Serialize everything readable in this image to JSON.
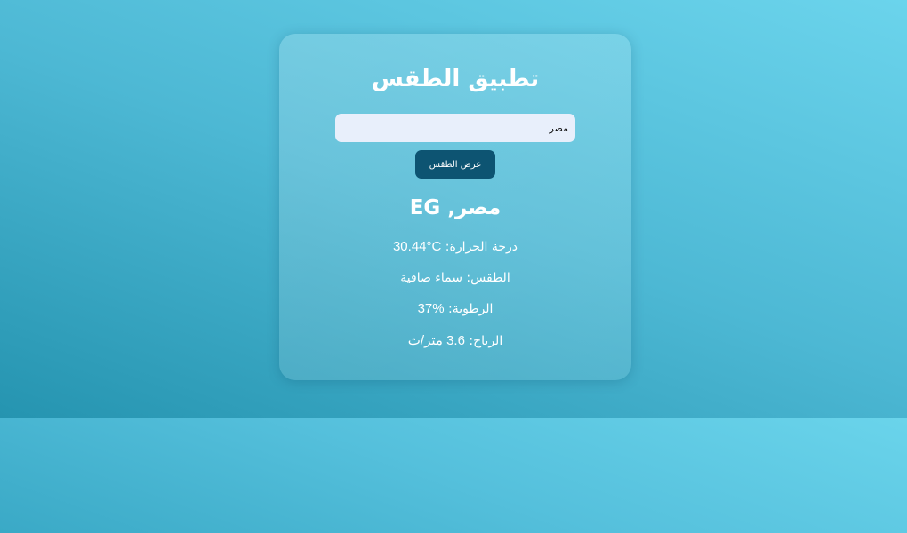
{
  "app": {
    "title": "تطبيق الطقس"
  },
  "search": {
    "value": "مصر",
    "button_label": "عرض الطقس"
  },
  "result": {
    "location": "مصر, EG",
    "temperature_label": "درجة الحرارة:",
    "temperature_value": "30.44°C",
    "weather_label": "الطقس:",
    "weather_value": "سماء صافية",
    "humidity_label": "الرطوبة:",
    "humidity_value": "37%",
    "wind_label": "الرياح:",
    "wind_value": "3.6 متر/ث"
  },
  "colors": {
    "button": "#0d5472",
    "input_bg": "#e8effb",
    "text": "#ffffff"
  }
}
